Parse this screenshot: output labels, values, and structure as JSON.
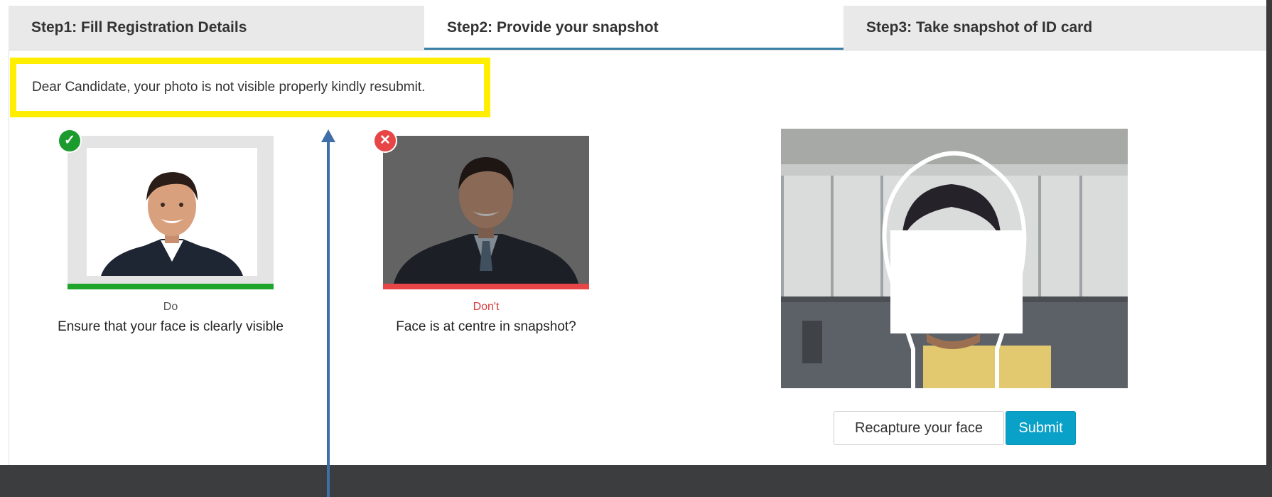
{
  "tabs": [
    {
      "label": "Step1: Fill Registration Details",
      "active": false
    },
    {
      "label": "Step2: Provide your snapshot",
      "active": true
    },
    {
      "label": "Step3: Take snapshot of ID card",
      "active": false
    }
  ],
  "alert": {
    "message": "Dear Candidate, your photo is not visible properly kindly resubmit.",
    "highlight_color": "#ffee00"
  },
  "examples": {
    "do": {
      "label": "Do",
      "caption": "Ensure that your face is clearly visible",
      "icon": "check-icon",
      "color": "#1fa52b"
    },
    "dont": {
      "label": "Don't",
      "caption": "Face is at centre in snapshot?",
      "icon": "close-icon",
      "color": "#e84646"
    }
  },
  "buttons": {
    "recapture": "Recapture your face",
    "submit": "Submit"
  },
  "colors": {
    "accent": "#0aa1c9",
    "tab_active_underline": "#3a7fa6"
  }
}
